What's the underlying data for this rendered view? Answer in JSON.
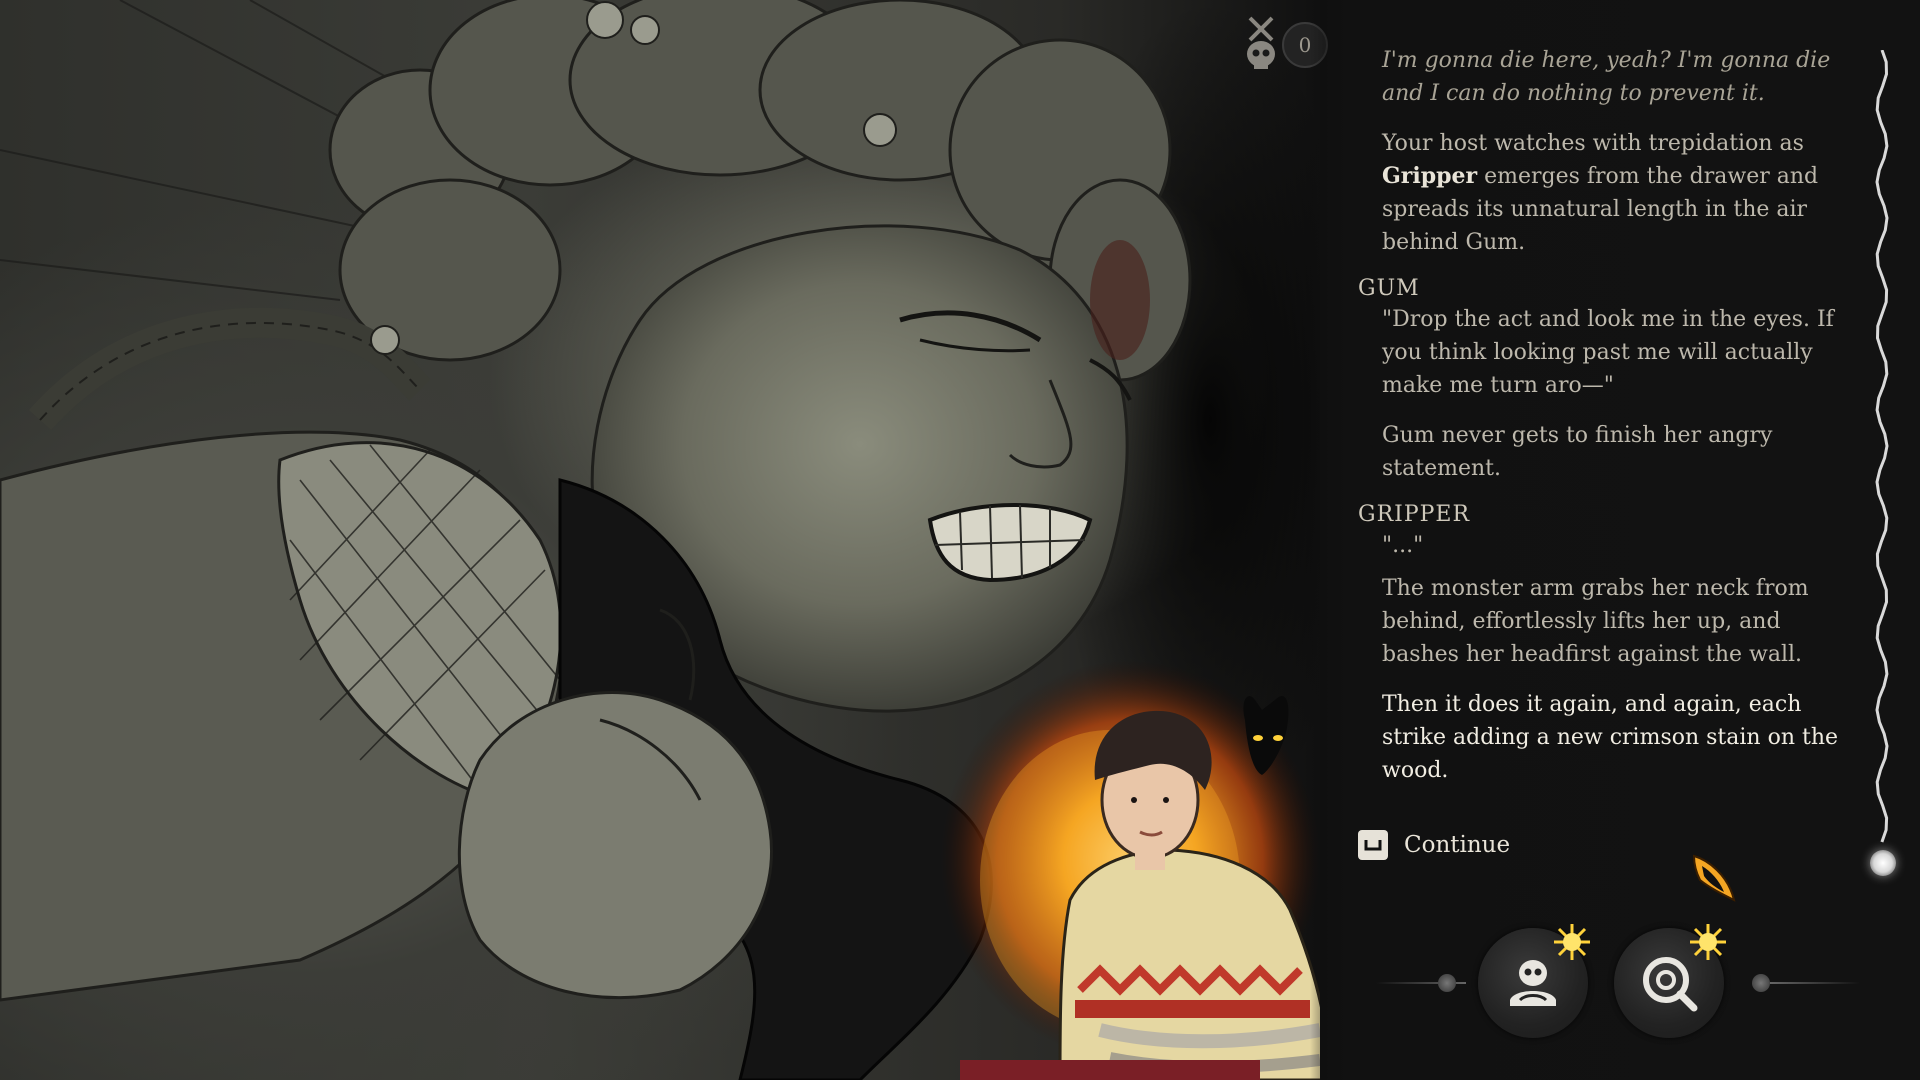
{
  "hud": {
    "counter_value": "0",
    "counter_icon": "crossed-skull-icon"
  },
  "dialogue": {
    "thought": "I'm gonna die here, yeah? I'm gonna die and I can do nothing to prevent it.",
    "narration1_pre": "Your host watches with trepidation as ",
    "narration1_bold": "Gripper",
    "narration1_post": " emerges from the drawer and spreads its unnatural length in the air behind Gum.",
    "speaker1": "GUM",
    "line1": "\"Drop the act and look me in the eyes. If you think looking past me will actually make me turn aro—\"",
    "narration2": "Gum never gets to finish her angry statement.",
    "speaker2": "GRIPPER",
    "line2": "\"...\"",
    "narration3": "The monster arm grabs her neck from behind, effortlessly lifts her up, and bashes her headfirst against the wall.",
    "narration4": "Then it does it again, and again, each strike adding a new crimson stain on the wood."
  },
  "continue": {
    "label": "Continue",
    "key_icon": "space-key-icon"
  },
  "skills": [
    {
      "name": "skull-mind-icon",
      "status": "sun-icon"
    },
    {
      "name": "magnify-eye-icon",
      "status": "sun-icon"
    }
  ],
  "colors": {
    "panel_bg": "#121212",
    "text": "#bdb8ac",
    "highlight_text": "#f1ede2",
    "fire": "#f5a623",
    "sun": "#ffd23a"
  }
}
